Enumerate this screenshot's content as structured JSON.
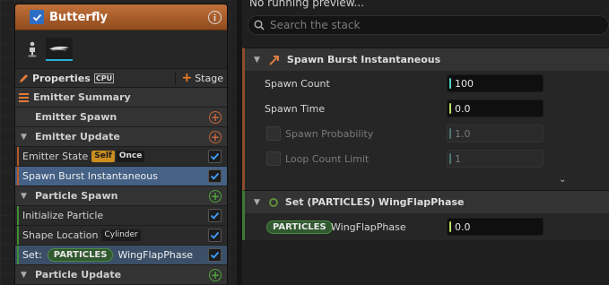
{
  "node": {
    "title": "Butterfly",
    "properties_label": "Properties",
    "cpu_badge": "CPU",
    "stage_label": "Stage",
    "emitter_summary": "Emitter Summary",
    "sections": {
      "emitter_spawn": "Emitter Spawn",
      "emitter_update": "Emitter Update",
      "particle_spawn": "Particle Spawn",
      "particle_update": "Particle Update"
    },
    "items": {
      "emitter_state": "Emitter State",
      "emitter_state_tag_self": "Self",
      "emitter_state_tag_once": "Once",
      "spawn_burst": "Spawn Burst Instantaneous",
      "initialize_particle": "Initialize Particle",
      "shape_location": "Shape Location",
      "shape_location_tag": "Cylinder",
      "set_prefix": "Set:",
      "set_pill": "PARTICLES",
      "set_name": "WingFlapPhase"
    }
  },
  "panel": {
    "preview_text": "No running preview...",
    "search_placeholder": "Search the stack",
    "spawn_burst": {
      "title": "Spawn Burst Instantaneous",
      "rows": {
        "spawn_count_label": "Spawn Count",
        "spawn_count_value": "100",
        "spawn_time_label": "Spawn Time",
        "spawn_time_value": "0.0",
        "spawn_probability_label": "Spawn Probability",
        "spawn_probability_value": "1.0",
        "loop_count_limit_label": "Loop Count Limit",
        "loop_count_limit_value": "1"
      }
    },
    "set_group": {
      "title": "Set (PARTICLES) WingFlapPhase",
      "pill": "PARTICLES",
      "param_label": "WingFlapPhase",
      "param_value": "0.0"
    }
  },
  "colors": {
    "header_orange": "#c2713a",
    "selected_row": "#456185",
    "accent_blue": "#2d6ec4",
    "particles_green": "#31592f"
  },
  "icons": [
    "check-icon",
    "info-icon",
    "figure-icon",
    "emitter-thumbnail-icon",
    "pencil-icon",
    "list-icon",
    "plus-icon",
    "search-icon",
    "chevron-down-icon",
    "chevron-right-icon",
    "module-arrow-icon",
    "circle-icon"
  ]
}
